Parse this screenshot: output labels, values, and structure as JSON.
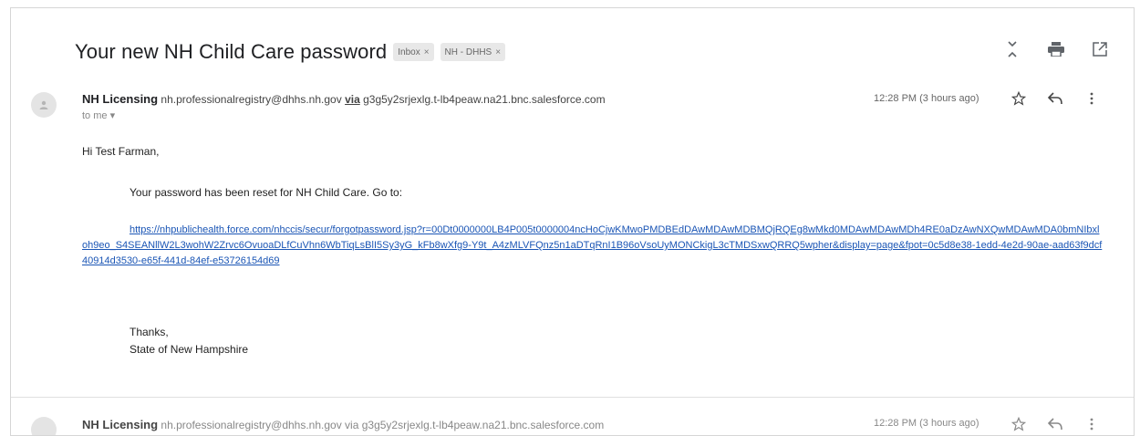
{
  "email": {
    "subject": "Your new NH Child Care password",
    "labels": [
      {
        "text": "Inbox",
        "close": "×"
      },
      {
        "text": "NH - DHHS",
        "close": "×"
      }
    ],
    "message": {
      "sender_name": "NH Licensing",
      "sender_email": "nh.professionalregistry@dhhs.nh.gov",
      "via_label": "via",
      "via_domain": "g3g5y2srjexlg.t-lb4peaw.na21.bnc.salesforce.com",
      "recipient": "to me",
      "time": "12:28 PM (3 hours ago)",
      "greeting": "Hi Test Farman,",
      "reset_line": "Your password has been reset for NH Child Care. Go to:",
      "link": "https://nhpublichealth.force.com/nhccis/secur/forgotpassword.jsp?r=00Dt0000000LB4P005t0000004ncHoCjwKMwoPMDBEdDAwMDAwMDBMQjRQEg8wMkd0MDAwMDAwMDh4RE0aDzAwNXQwMDAwMDA0bmNIbxloh9eo_S4SEANllW2L3wohW2Zrvc6OvuoaDLfCuVhn6WbTiqLsBlI5Sy3yG_kFb8wXfg9-Y9t_A4zMLVFQnz5n1aDTqRnI1B96oVsoUyMONCkigL3cTMDSxwQRRQ5wpher&display=page&fpot=0c5d8e38-1edd-4e2d-90ae-aad63f9dcf40914d3530-e65f-441d-84ef-e53726154d69",
      "thanks": "Thanks,",
      "signature": "State of New Hampshire"
    },
    "next_message": {
      "sender_name": "NH Licensing",
      "sender_preview": "nh.professionalregistry@dhhs.nh.gov via g3g5y2srjexlg.t-lb4peaw.na21.bnc.salesforce.com",
      "time": "12:28 PM (3 hours ago)"
    }
  },
  "icons": {
    "expand": "expand-all-icon",
    "print": "print-icon",
    "new_window": "open-new-window-icon",
    "star": "star-icon",
    "reply": "reply-icon",
    "more": "more-vert-icon"
  }
}
